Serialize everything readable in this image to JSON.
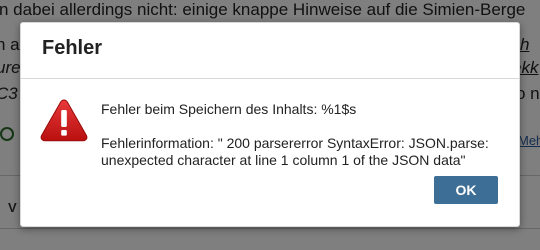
{
  "background": {
    "line1": "n dabei allerdings nicht: einige knappe Hinweise auf die Simien-Berge",
    "line2_right": "seh",
    "line3_left": "ure",
    "line3_right": "ekk",
    "line4_left": "C3",
    "line4_right": "o n",
    "link_right": "Meh",
    "letter_v": "V",
    "line2_left": "n a"
  },
  "dialog": {
    "title": "Fehler",
    "icon": "warning-icon",
    "message_line1": "Fehler beim Speichern des Inhalts: %1$s",
    "message_line2": "Fehlerinformation: \" 200 parsererror SyntaxError: JSON.parse: unexpected character at line 1 column 1 of the JSON data\"",
    "ok_label": "OK"
  },
  "colors": {
    "ok_button": "#3d6f96",
    "warning_red": "#cc1a1a",
    "overlay": "rgba(0,0,0,0.5)"
  }
}
